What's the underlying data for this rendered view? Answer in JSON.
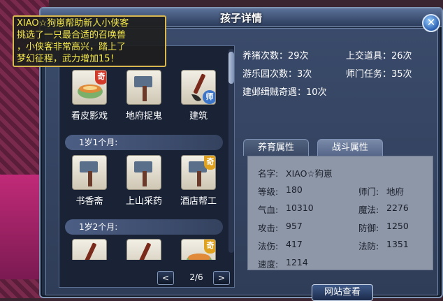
{
  "window": {
    "title": "孩子详情",
    "close_label": "✕"
  },
  "tooltip": {
    "lines": [
      "XIAO☆狗崽帮助新人小侠客",
      "挑选了一只最合适的召唤兽",
      "，小侠客非常高兴，踏上了",
      "梦幻征程，武力增加15！"
    ]
  },
  "list": {
    "row1": [
      {
        "label": "看皮影戏",
        "badge": "奇",
        "icon": "bowl-icon"
      },
      {
        "label": "地府捉鬼",
        "badge": "",
        "icon": "hammer-icon"
      },
      {
        "label": "建筑",
        "badge": "师",
        "icon": "brush-icon"
      }
    ],
    "group1": "1岁1个月:",
    "row2": [
      {
        "label": "书香斋",
        "badge": "",
        "icon": "hammer-icon"
      },
      {
        "label": "上山采药",
        "badge": "",
        "icon": "hammer-icon"
      },
      {
        "label": "酒店帮工",
        "badge": "奇",
        "icon": "hammer-icon"
      }
    ],
    "group2": "1岁2个月:",
    "row3": [
      {
        "label": "",
        "badge": "",
        "icon": "brush-icon"
      },
      {
        "label": "",
        "badge": "",
        "icon": "brush-icon"
      },
      {
        "label": "",
        "badge": "奇",
        "icon": "bowl-icon"
      }
    ],
    "pager": {
      "prev": "<",
      "page": "2/6",
      "next": ">"
    }
  },
  "stats": {
    "feed_pig": "养猪次数：29次",
    "hand_in": "上交道具：26次",
    "park": "游乐园次数：3次",
    "master_task": "师门任务：35次",
    "event": "建邺缉贼奇遇：10次"
  },
  "tabs": {
    "nurture": "养育属性",
    "combat": "战斗属性"
  },
  "attributes": {
    "name_label": "名字:",
    "name": "XIAO☆狗崽",
    "level_label": "等级:",
    "level": "180",
    "school_label": "师门:",
    "school": "地府",
    "hp_label": "气血:",
    "hp": "10310",
    "mp_label": "魔法:",
    "mp": "2276",
    "atk_label": "攻击:",
    "atk": "957",
    "def_label": "防御:",
    "def": "1250",
    "magic_dmg_label": "法伤:",
    "magic_dmg": "417",
    "magic_def_label": "法防:",
    "magic_def": "1351",
    "speed_label": "速度:",
    "speed": "1214"
  },
  "web_button": "网站查看"
}
